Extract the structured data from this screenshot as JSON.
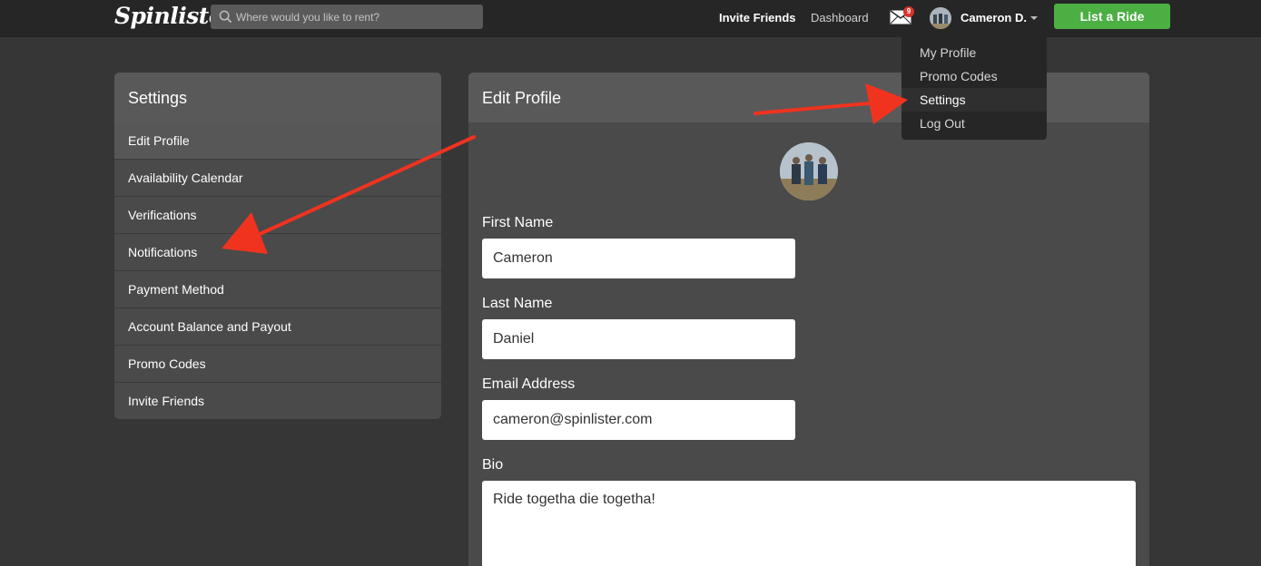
{
  "nav": {
    "logo": "Spinlister",
    "search_placeholder": "Where would you like to rent?",
    "invite": "Invite Friends",
    "dashboard": "Dashboard",
    "mail_count": "9",
    "user_name": "Cameron D.",
    "list_ride": "List a Ride"
  },
  "dropdown": {
    "items": [
      {
        "label": "My Profile"
      },
      {
        "label": "Promo Codes"
      },
      {
        "label": "Settings"
      },
      {
        "label": "Log Out"
      }
    ]
  },
  "sidebar": {
    "title": "Settings",
    "items": [
      {
        "label": "Edit Profile"
      },
      {
        "label": "Availability Calendar"
      },
      {
        "label": "Verifications"
      },
      {
        "label": "Notifications"
      },
      {
        "label": "Payment Method"
      },
      {
        "label": "Account Balance and Payout"
      },
      {
        "label": "Promo Codes"
      },
      {
        "label": "Invite Friends"
      }
    ]
  },
  "profile": {
    "title": "Edit Profile",
    "first_name_label": "First Name",
    "first_name": "Cameron",
    "last_name_label": "Last Name",
    "last_name": "Daniel",
    "email_label": "Email Address",
    "email": "cameron@spinlister.com",
    "bio_label": "Bio",
    "bio": "Ride togetha die togetha!"
  },
  "colors": {
    "accent_green": "#4caf43",
    "badge_red": "#d9342b",
    "annotation_arrow": "#f0331f"
  }
}
